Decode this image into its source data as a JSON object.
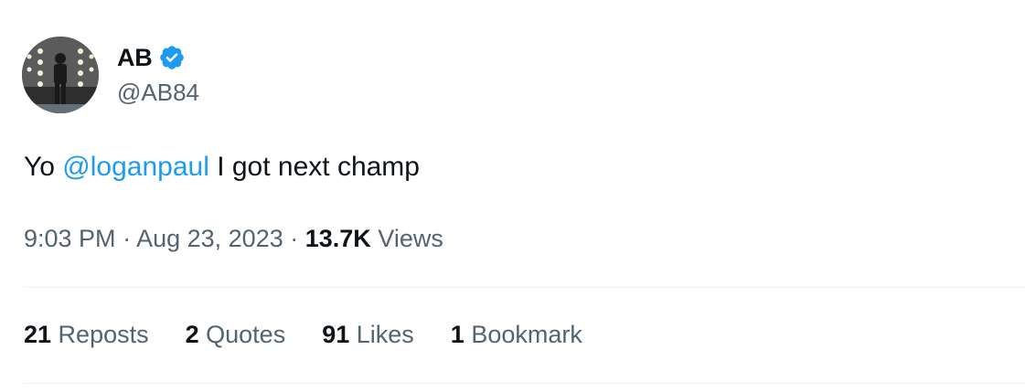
{
  "author": {
    "display_name": "AB",
    "handle": "@AB84",
    "verified": true,
    "avatar": "profile-photo"
  },
  "tweet": {
    "text_before": "Yo ",
    "mention": "@loganpaul",
    "text_after": " I got next champ",
    "time": "9:03 PM",
    "separator": " · ",
    "date": "Aug 23, 2023",
    "views_count": "13.7K",
    "views_label": " Views"
  },
  "stats": [
    {
      "count": "21",
      "label": " Reposts"
    },
    {
      "count": "2",
      "label": " Quotes"
    },
    {
      "count": "91",
      "label": " Likes"
    },
    {
      "count": "1",
      "label": " Bookmark"
    }
  ],
  "colors": {
    "accent": "#1d9bf0",
    "text": "#0f1419",
    "secondary": "#536471",
    "divider": "#eff3f4"
  }
}
